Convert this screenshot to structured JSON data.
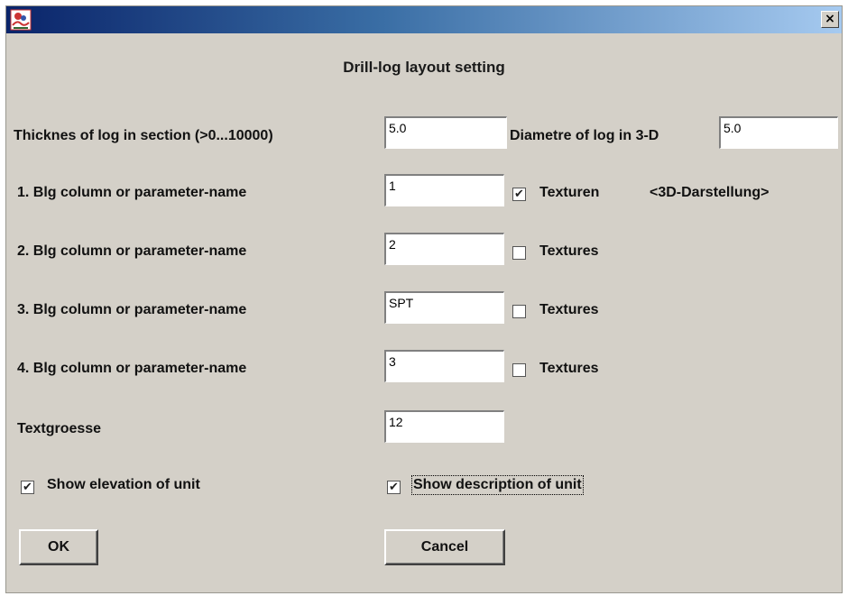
{
  "window": {
    "close_glyph": "×",
    "icon": "app-logo-icon"
  },
  "dialog": {
    "title": "Drill-log layout setting"
  },
  "log_size": {
    "thickness_label": "Thicknes of log in section (>0...10000)",
    "thickness_value": "5.0",
    "diameter_label": "Diametre of log in 3-D",
    "diameter_value": "5.0"
  },
  "columns": [
    {
      "label": "1. Blg column or parameter-name",
      "value": "1",
      "checkbox_label": "Texturen",
      "checked": true,
      "note": "<3D-Darstellung>"
    },
    {
      "label": "2. Blg column or parameter-name",
      "value": "2",
      "checkbox_label": "Textures",
      "checked": false
    },
    {
      "label": "3. Blg column or parameter-name",
      "value": "SPT",
      "checkbox_label": "Textures",
      "checked": false
    },
    {
      "label": "4. Blg column or parameter-name",
      "value": "3",
      "checkbox_label": "Textures",
      "checked": false
    }
  ],
  "text_size": {
    "label": "Textgroesse",
    "value": "12"
  },
  "options": {
    "show_elevation_label": "Show elevation of unit",
    "show_elevation_checked": true,
    "show_description_label": "Show description of unit",
    "show_description_checked": true
  },
  "buttons": {
    "ok": "OK",
    "cancel": "Cancel"
  },
  "colors": {
    "titlebar_start": "#0a246a",
    "titlebar_end": "#a6caf0",
    "dialog_bg": "#d4d0c8"
  }
}
